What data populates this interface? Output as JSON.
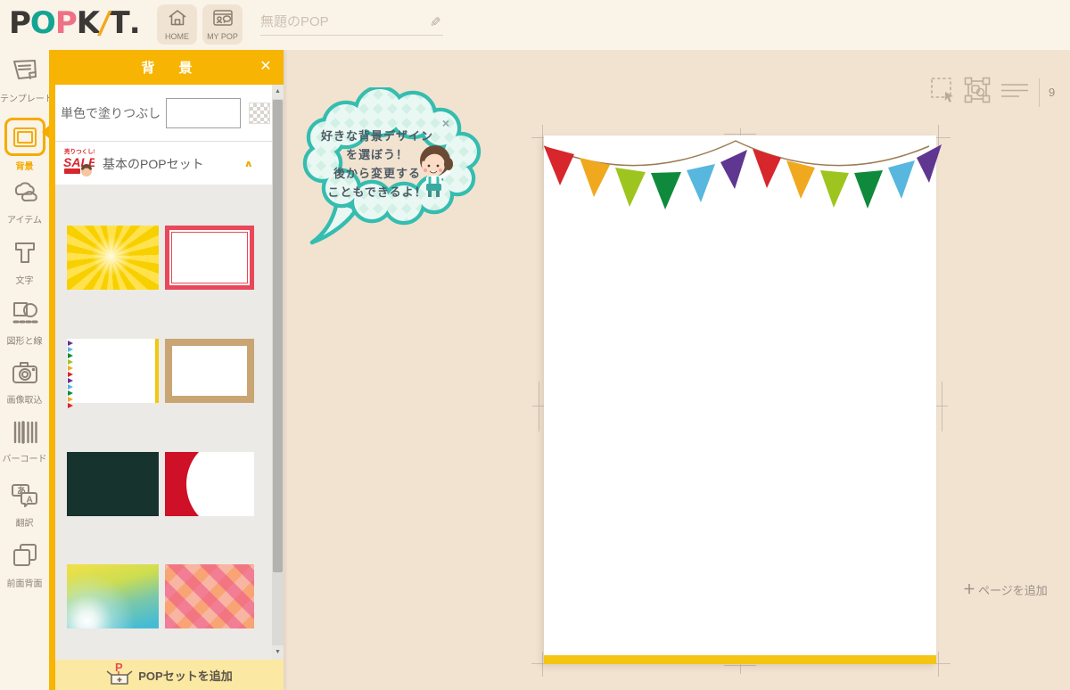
{
  "header": {
    "logo_letters": [
      {
        "ch": "P",
        "color": "#3b3835"
      },
      {
        "ch": "O",
        "color": "#15a493"
      },
      {
        "ch": "P",
        "color": "#ef7186"
      },
      {
        "ch": "K",
        "color": "#3b3835"
      },
      {
        "ch": "/",
        "color": "#f2a71b"
      },
      {
        "ch": "T",
        "color": "#3b3835"
      },
      {
        "ch": ".",
        "color": "#3b3835"
      }
    ],
    "home_label": "HOME",
    "mypop_label": "MY POP",
    "title_placeholder": "無題のPOP",
    "pencil_icon": "✎"
  },
  "sidebar": {
    "items": [
      {
        "label": "テンプレート",
        "active": false
      },
      {
        "label": "背景",
        "active": true
      },
      {
        "label": "アイテム",
        "active": false
      },
      {
        "label": "文字",
        "active": false
      },
      {
        "label": "図形と線",
        "active": false
      },
      {
        "label": "画像取込",
        "active": false
      },
      {
        "label": "バーコード",
        "active": false
      },
      {
        "label": "翻訳",
        "active": false
      },
      {
        "label": "前面背面",
        "active": false
      }
    ]
  },
  "panel": {
    "title": "背　景",
    "close_icon": "✕",
    "solid_fill_label": "単色で塗りつぶし",
    "section": {
      "badge_text": "SALE",
      "title": "基本のPOPセット",
      "collapse_icon": "∧"
    },
    "thumbnails": [
      "sunburst-yellow",
      "red-border-frame",
      "white-bunting-yellow-stripe",
      "kraft-paper-frame",
      "dark-green-solid",
      "red-white-crescent",
      "yellow-teal-glow-gradient",
      "pink-orange-gingham"
    ],
    "scrollbar": {
      "up_icon": "▲",
      "down_icon": "▼"
    },
    "add_popset_label": "POPセットを追加"
  },
  "tooltip": {
    "lines": [
      "好きな背景デザイン",
      "を選ぼう！",
      "後から変更する",
      "こともできるよ！"
    ],
    "close_icon": "×"
  },
  "canvas": {
    "zoom_indicator": "9",
    "plus_icon": "＋",
    "add_page_label": "ページを追加"
  },
  "colors": {
    "accent_yellow": "#f7b402",
    "panel_bottom_yellow": "#fbe8a3",
    "header_bg": "#faf3e8",
    "canvas_bg": "#f2e3d1",
    "page_bottom_bar": "#f6c413",
    "bubble_teal": "#35bdaf",
    "bubble_fill": "#eaf8f4",
    "flag_colors": [
      "#d7262c",
      "#f0a91f",
      "#9ec51f",
      "#0f8a3c",
      "#57b7de",
      "#5f3690"
    ]
  }
}
